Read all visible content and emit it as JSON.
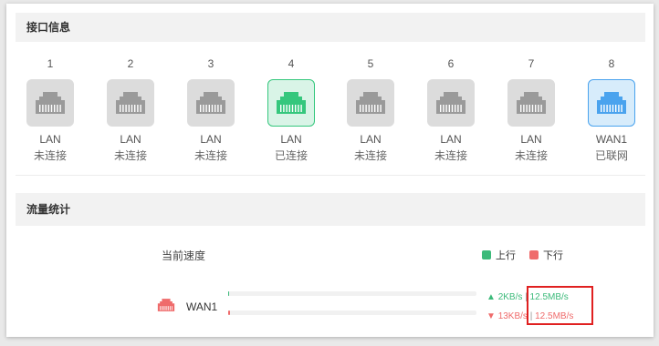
{
  "colors": {
    "connected": "#35c77d",
    "wan": "#4aa3ee",
    "inactive": "#9a9a9a",
    "upload": "#3cba7a",
    "download": "#ef6b6b",
    "highlight": "#e02020"
  },
  "ports_section": {
    "title": "接口信息"
  },
  "ports": [
    {
      "number": "1",
      "type": "LAN",
      "status": "未连接",
      "state": "inactive",
      "icon": "ethernet-port-icon"
    },
    {
      "number": "2",
      "type": "LAN",
      "status": "未连接",
      "state": "inactive",
      "icon": "ethernet-port-icon"
    },
    {
      "number": "3",
      "type": "LAN",
      "status": "未连接",
      "state": "inactive",
      "icon": "ethernet-port-icon"
    },
    {
      "number": "4",
      "type": "LAN",
      "status": "已连接",
      "state": "connected",
      "icon": "ethernet-port-icon"
    },
    {
      "number": "5",
      "type": "LAN",
      "status": "未连接",
      "state": "inactive",
      "icon": "ethernet-port-icon"
    },
    {
      "number": "6",
      "type": "LAN",
      "status": "未连接",
      "state": "inactive",
      "icon": "ethernet-port-icon"
    },
    {
      "number": "7",
      "type": "LAN",
      "status": "未连接",
      "state": "inactive",
      "icon": "ethernet-port-icon"
    },
    {
      "number": "8",
      "type": "WAN1",
      "status": "已联网",
      "state": "wan",
      "icon": "ethernet-port-icon"
    }
  ],
  "traffic_section": {
    "title": "流量统计",
    "speed_label": "当前速度",
    "legend": {
      "upload": "上行",
      "download": "下行"
    },
    "rows": [
      {
        "name": "WAN1",
        "icon": "wan-port-icon",
        "upload_marker": "▲",
        "upload_current": "2KB/s",
        "upload_max": "12.5MB/s",
        "download_marker": "▼",
        "download_current": "13KB/s",
        "download_max": "12.5MB/s",
        "upload_fraction": 0.0002,
        "download_fraction": 0.001
      }
    ]
  }
}
